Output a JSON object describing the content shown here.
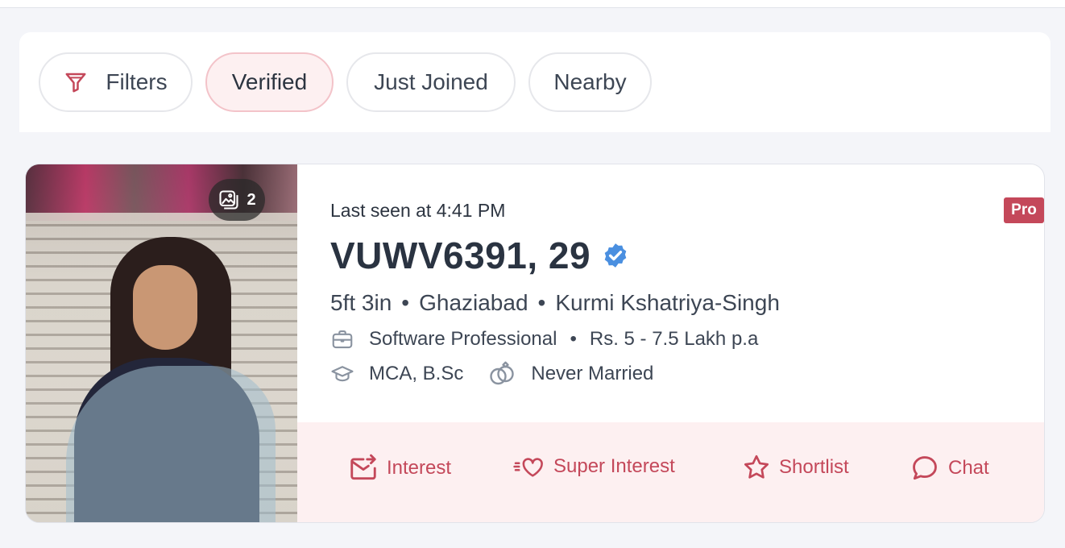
{
  "filters": [
    {
      "label": "Filters",
      "icon": "filter-icon",
      "active": false
    },
    {
      "label": "Verified",
      "active": true
    },
    {
      "label": "Just Joined",
      "active": false
    },
    {
      "label": "Nearby",
      "active": false
    }
  ],
  "profile": {
    "photo_count": "2",
    "last_seen": "Last seen at 4:41 PM",
    "name_age": "VUWV6391, 29",
    "verified": true,
    "badge": "Pro",
    "height": "5ft 3in",
    "city": "Ghaziabad",
    "community": "Kurmi Kshatriya-Singh",
    "profession": "Software Professional",
    "income": "Rs. 5 - 7.5 Lakh p.a",
    "education": "MCA, B.Sc",
    "marital_status": "Never Married",
    "bullet": "•"
  },
  "actions": [
    {
      "label": "Interest",
      "icon": "envelope-arrow-icon"
    },
    {
      "label": "Super Interest",
      "icon": "heart-speed-icon"
    },
    {
      "label": "Shortlist",
      "icon": "star-icon"
    },
    {
      "label": "Chat",
      "icon": "chat-bubble-icon"
    }
  ],
  "colors": {
    "accent": "#c4485a",
    "verified_blue": "#4a8fe0",
    "action_bg": "#fdf0f1",
    "active_chip_bg": "#fdf0f1",
    "page_bg": "#f4f5f9"
  }
}
